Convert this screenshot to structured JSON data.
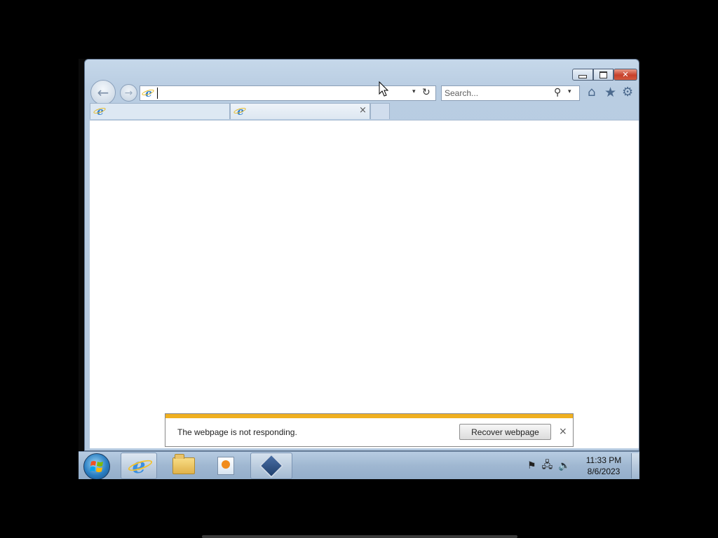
{
  "window": {
    "minimize_icon": "minimize-icon",
    "maximize_icon": "maximize-icon",
    "close_icon": "close-icon",
    "close_glyph": "✕"
  },
  "nav": {
    "back_glyph": "←",
    "forward_glyph": "→"
  },
  "address": {
    "value": "",
    "dropdown_glyph": "▾",
    "refresh_glyph": "↻"
  },
  "search": {
    "placeholder": "Search...",
    "icon_glyph": "⚲",
    "dropdown_glyph": "▾"
  },
  "toolbar": {
    "home_glyph": "⌂",
    "favorites_glyph": "★",
    "tools_glyph": "⚙"
  },
  "tabs": [
    {
      "label": "",
      "icon": "ie-icon"
    },
    {
      "label": "",
      "icon": "ie-icon",
      "close_glyph": "×"
    }
  ],
  "notification": {
    "message": "The webpage is not responding.",
    "button_label": "Recover webpage",
    "close_glyph": "×",
    "accent_color": "#f0b020"
  },
  "taskbar": {
    "pinned": [
      "internet-explorer",
      "windows-explorer",
      "media-player",
      "virtualbox"
    ],
    "tray_icons": [
      "action-center-flag-icon",
      "network-icon",
      "volume-icon"
    ],
    "tray_glyphs": [
      "⚑",
      "🖧",
      "🔊"
    ],
    "clock_time": "11:33 PM",
    "clock_date": "8/6/2023"
  }
}
